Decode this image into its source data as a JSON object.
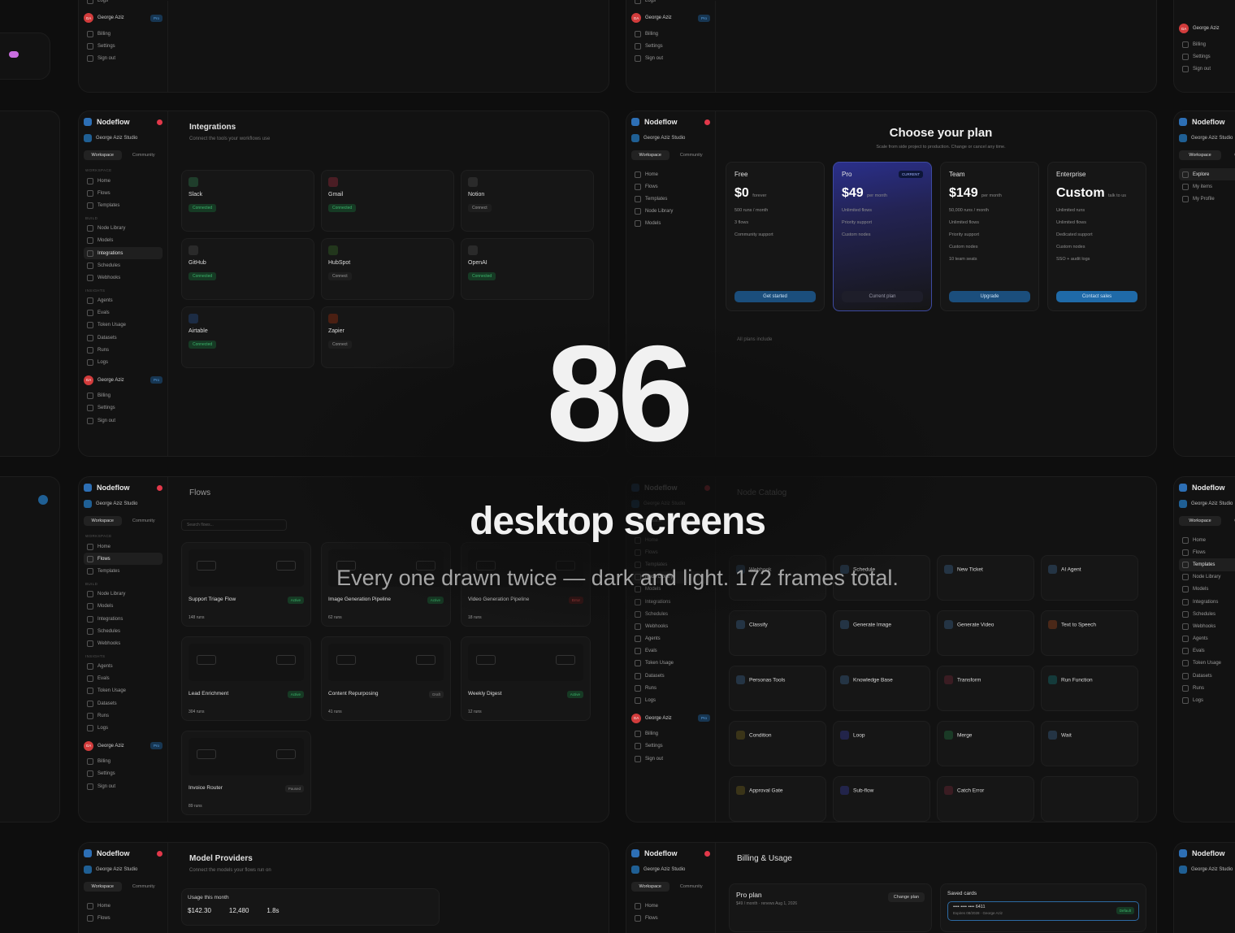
{
  "hero": {
    "count": "86",
    "subtitle": "desktop screens",
    "tagline": "Every one drawn twice — dark and light. 172 frames total."
  },
  "app": {
    "brand": "Nodeflow",
    "studio": "George Aziz Studio",
    "tabs": [
      "Workspace",
      "Community"
    ],
    "sections": {
      "workspace": "Workspace",
      "build": "Build",
      "insights": "Insights"
    },
    "nav_workspace": [
      "Home",
      "Flows",
      "Templates"
    ],
    "nav_build": [
      "Node Library",
      "Models",
      "Integrations",
      "Schedules",
      "Webhooks"
    ],
    "nav_insights": [
      "Agents",
      "Evals",
      "Token Usage",
      "Datasets",
      "Runs",
      "Logs"
    ],
    "user": {
      "initials": "GA",
      "name": "George Aziz",
      "badge": "Pro"
    },
    "account": [
      "Billing",
      "Settings",
      "Sign out"
    ]
  },
  "integrations": {
    "title": "Integrations",
    "subtitle": "Connect the tools your workflows use",
    "items": [
      {
        "name": "Slack",
        "status": "Connected"
      },
      {
        "name": "Gmail",
        "status": "Connected"
      },
      {
        "name": "Notion",
        "status": "Connect"
      },
      {
        "name": "GitHub",
        "status": "Connected"
      },
      {
        "name": "HubSpot",
        "status": "Connect"
      },
      {
        "name": "OpenAI",
        "status": "Connected"
      },
      {
        "name": "Airtable",
        "status": "Connected"
      },
      {
        "name": "Zapier",
        "status": "Connect"
      }
    ]
  },
  "pricing": {
    "title": "Choose your plan",
    "subtitle": "Scale from side project to production. Change or cancel any time.",
    "plans": [
      {
        "name": "Free",
        "price": "$0",
        "per": "forever",
        "features": [
          "500 runs / month",
          "3 flows",
          "Community support"
        ],
        "button": "Get started"
      },
      {
        "name": "Pro",
        "price": "$49",
        "per": "per month",
        "badge": "CURRENT",
        "features": [
          "Unlimited flows",
          "Priority support",
          "Custom nodes"
        ],
        "button": "Current plan"
      },
      {
        "name": "Team",
        "price": "$149",
        "per": "per month",
        "features": [
          "50,000 runs / month",
          "Unlimited flows",
          "Priority support",
          "Custom nodes",
          "10 team seats"
        ],
        "button": "Upgrade"
      },
      {
        "name": "Enterprise",
        "price": "Custom",
        "per": "talk to us",
        "features": [
          "Unlimited runs",
          "Unlimited flows",
          "Dedicated support",
          "Custom nodes",
          "SSO + audit logs"
        ],
        "button": "Contact sales"
      }
    ],
    "included_label": "All plans include"
  },
  "flows": {
    "title": "Flows",
    "search_placeholder": "Search flows...",
    "items": [
      {
        "name": "Support Triage Flow",
        "status": "Active",
        "runs": "148 runs"
      },
      {
        "name": "Image Generation Pipeline",
        "status": "Active",
        "runs": "62 runs"
      },
      {
        "name": "Video Generation Pipeline",
        "status": "Error",
        "runs": "18 runs"
      },
      {
        "name": "Lead Enrichment",
        "status": "Active",
        "runs": "304 runs"
      },
      {
        "name": "Content Repurposing",
        "status": "Draft",
        "runs": "41 runs"
      },
      {
        "name": "Weekly Digest",
        "status": "Active",
        "runs": "12 runs"
      },
      {
        "name": "Invoice Router",
        "status": "Paused",
        "runs": "89 runs"
      }
    ]
  },
  "catalog": {
    "title": "Node Catalog",
    "nodes": [
      "Webhook",
      "Schedule",
      "New Ticket",
      "AI Agent",
      "Classify",
      "Generate Image",
      "Generate Video",
      "Text to Speech",
      "Personas Tools",
      "Knowledge Base",
      "Transform",
      "Run Function",
      "Condition",
      "Loop",
      "Merge",
      "Wait",
      "Approval Gate",
      "Sub-flow",
      "Catch Error"
    ]
  },
  "models": {
    "title": "Model Providers",
    "subtitle": "Connect the models your flows run on",
    "usage_label": "Usage this month",
    "spend": "$142.30",
    "requests": "12,480",
    "latency": "1.8s"
  },
  "billing": {
    "title": "Billing & Usage",
    "plan_name": "Pro plan",
    "plan_meta": "$49 / month · renews Aug 1, 2026",
    "change_button": "Change plan",
    "cards_label": "Saved cards",
    "card_number": "•••• •••• •••• 6411",
    "card_expiry": "Expires 08/2028 · George Aziz",
    "card_default": "Default"
  },
  "explore": {
    "items": [
      "Explore",
      "My items",
      "My Profile"
    ]
  }
}
